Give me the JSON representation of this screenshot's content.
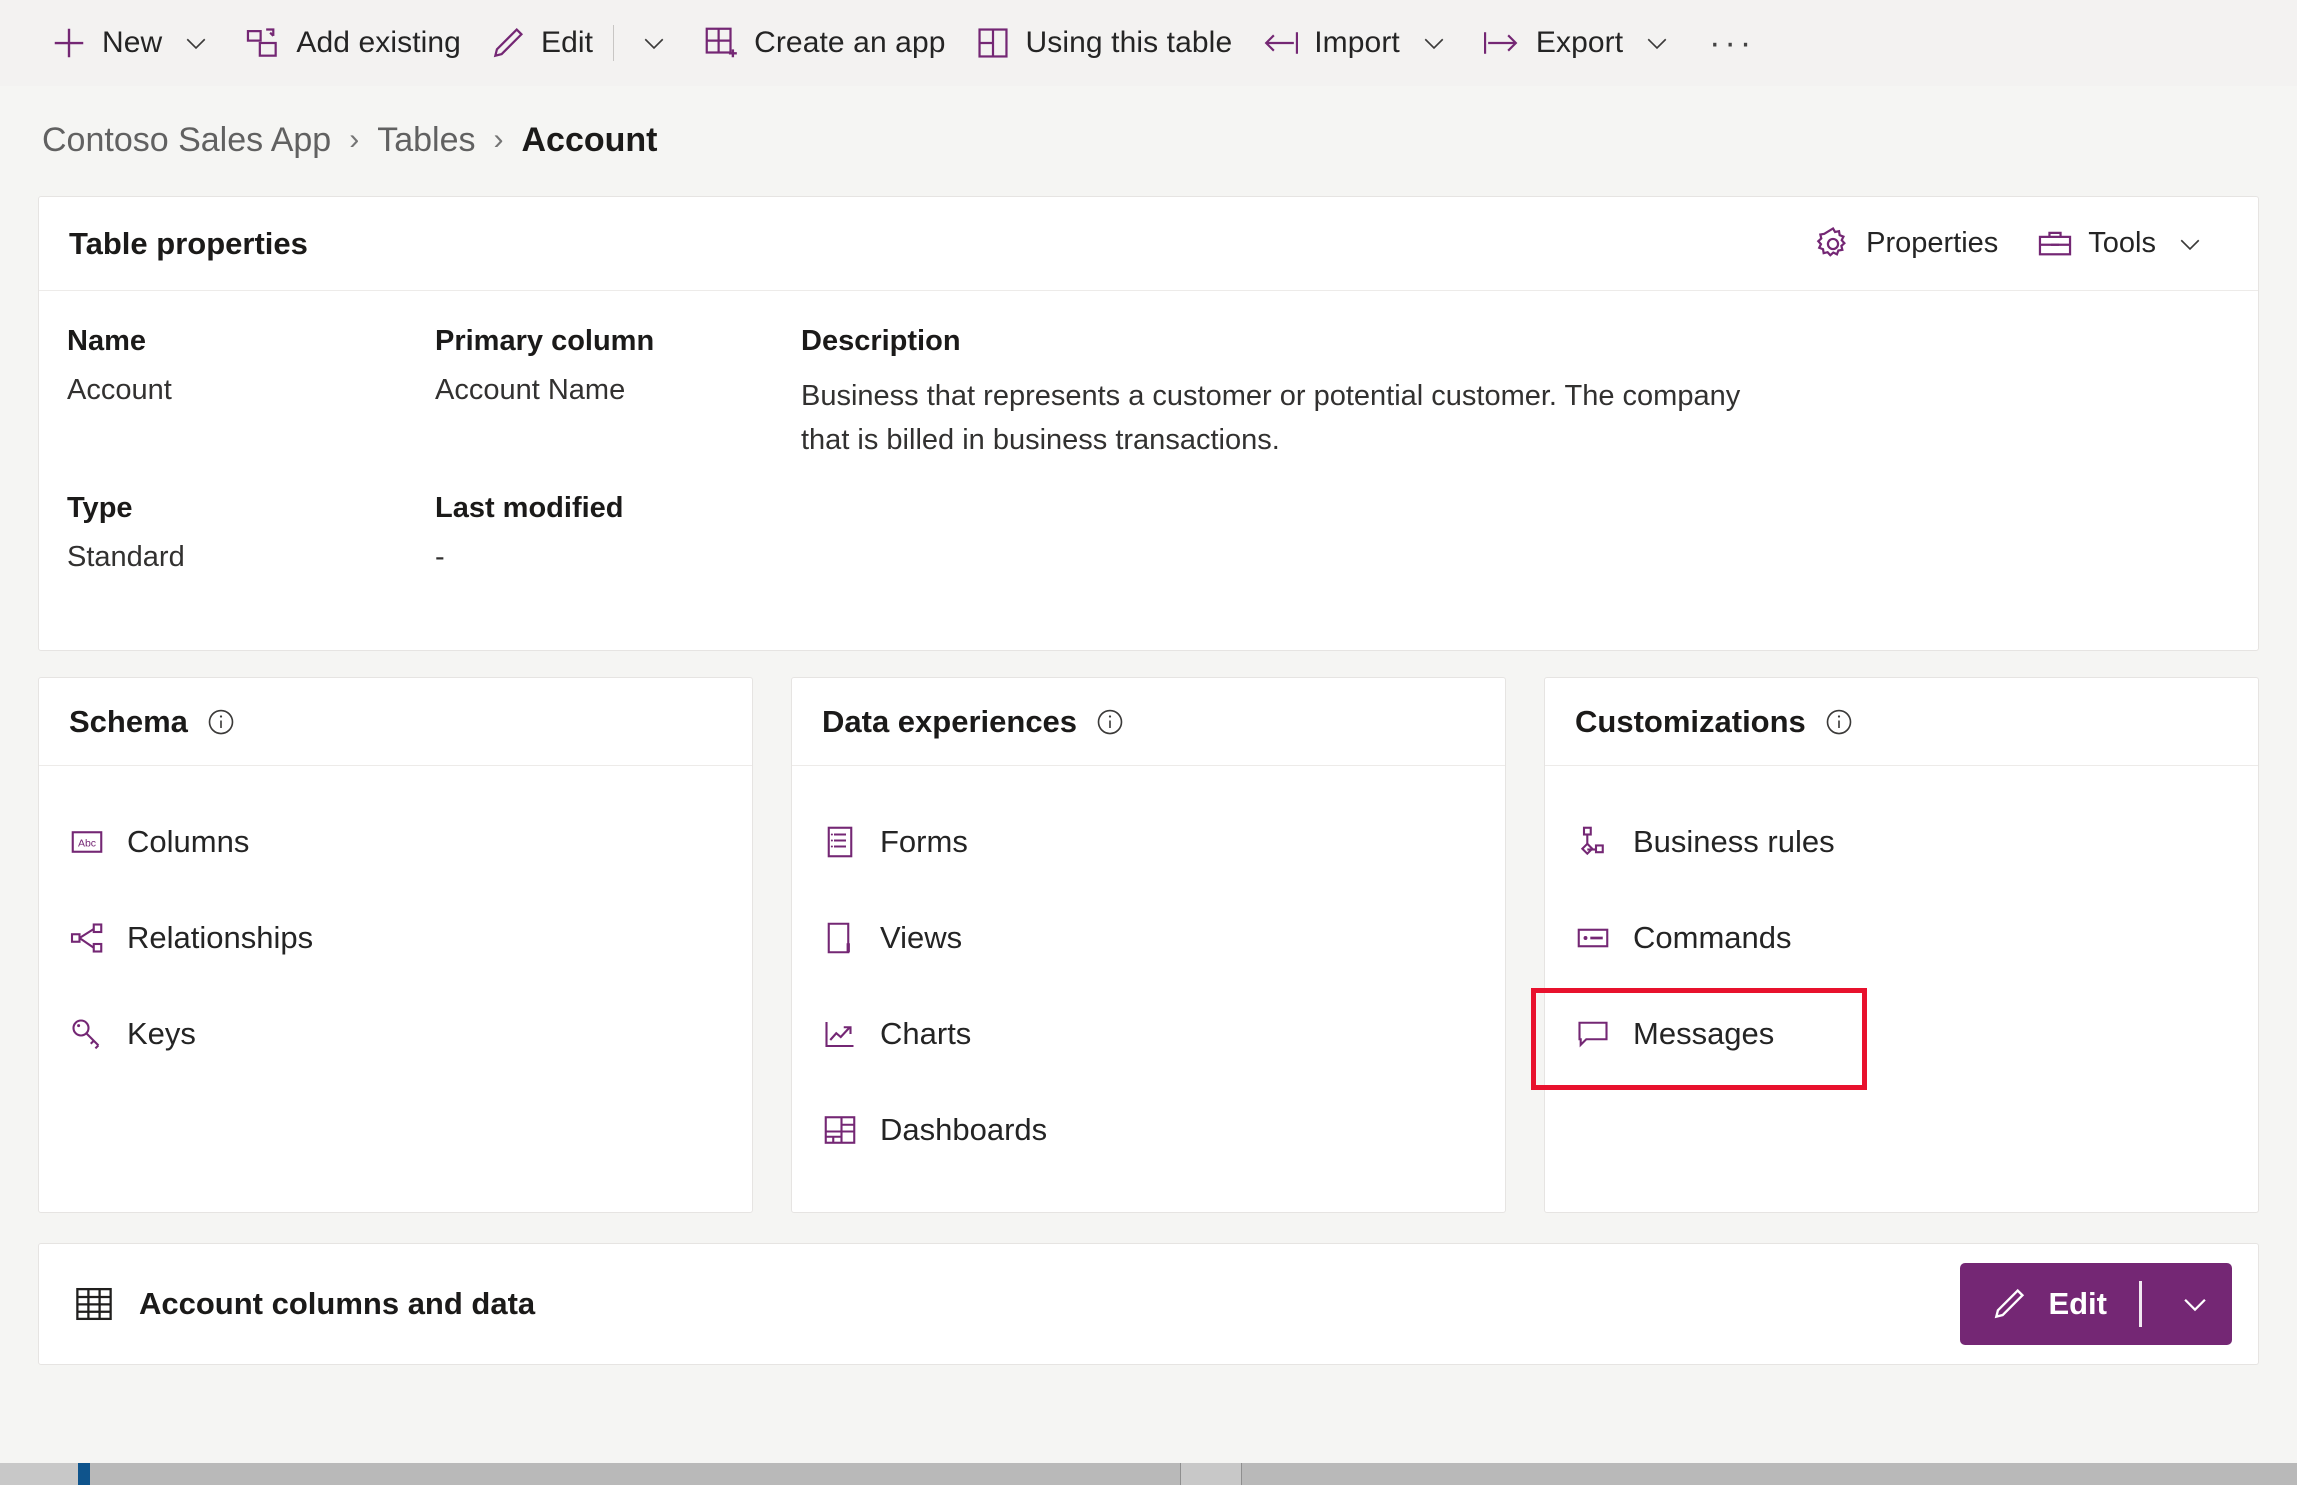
{
  "commandbar": {
    "items": [
      {
        "label": "New",
        "icon": "plus-icon",
        "chevron": true
      },
      {
        "label": "Add existing",
        "icon": "add-existing-icon",
        "chevron": false
      },
      {
        "label": "Edit",
        "icon": "pencil-icon",
        "chevron": true,
        "split": true
      },
      {
        "label": "Create an app",
        "icon": "create-app-icon",
        "chevron": false
      },
      {
        "label": "Using this table",
        "icon": "using-table-icon",
        "chevron": false
      },
      {
        "label": "Import",
        "icon": "import-icon",
        "chevron": true
      },
      {
        "label": "Export",
        "icon": "export-icon",
        "chevron": true
      }
    ],
    "overflow_label": "···"
  },
  "breadcrumb": {
    "items": [
      "Contoso Sales App",
      "Tables",
      "Account"
    ],
    "separator": "›"
  },
  "table_properties": {
    "title": "Table properties",
    "actions": [
      {
        "label": "Properties",
        "icon": "gear-icon",
        "chevron": false
      },
      {
        "label": "Tools",
        "icon": "toolbox-icon",
        "chevron": true
      }
    ],
    "fields": [
      {
        "label": "Name",
        "value": "Account"
      },
      {
        "label": "Primary column",
        "value": "Account Name"
      },
      {
        "label": "Type",
        "value": "Standard"
      },
      {
        "label": "Last modified",
        "value": "-"
      }
    ],
    "description_label": "Description",
    "description_value": "Business that represents a customer or potential customer. The company that is billed in business transactions."
  },
  "cards": [
    {
      "title": "Schema",
      "info_icon": "info-icon",
      "items": [
        {
          "label": "Columns",
          "icon": "abc-icon",
          "highlighted": false
        },
        {
          "label": "Relationships",
          "icon": "relationships-icon",
          "highlighted": false
        },
        {
          "label": "Keys",
          "icon": "key-icon",
          "highlighted": false
        }
      ]
    },
    {
      "title": "Data experiences",
      "info_icon": "info-icon",
      "items": [
        {
          "label": "Forms",
          "icon": "form-icon",
          "highlighted": false
        },
        {
          "label": "Views",
          "icon": "views-icon",
          "highlighted": false
        },
        {
          "label": "Charts",
          "icon": "chart-icon",
          "highlighted": false
        },
        {
          "label": "Dashboards",
          "icon": "dashboard-icon",
          "highlighted": false
        }
      ]
    },
    {
      "title": "Customizations",
      "info_icon": "info-icon",
      "items": [
        {
          "label": "Business rules",
          "icon": "business-rules-icon",
          "highlighted": false
        },
        {
          "label": "Commands",
          "icon": "commands-icon",
          "highlighted": false
        },
        {
          "label": "Messages",
          "icon": "message-icon",
          "highlighted": true
        }
      ]
    }
  ],
  "bottom": {
    "title": "Account columns and data",
    "icon": "table-grid-icon",
    "edit_label": "Edit"
  },
  "colors": {
    "accent_purple": "#742774",
    "highlight_red": "#e8112d",
    "page_background": "#f5f5f3",
    "commandbar_background": "#f3f2f1",
    "card_background": "#ffffff"
  }
}
